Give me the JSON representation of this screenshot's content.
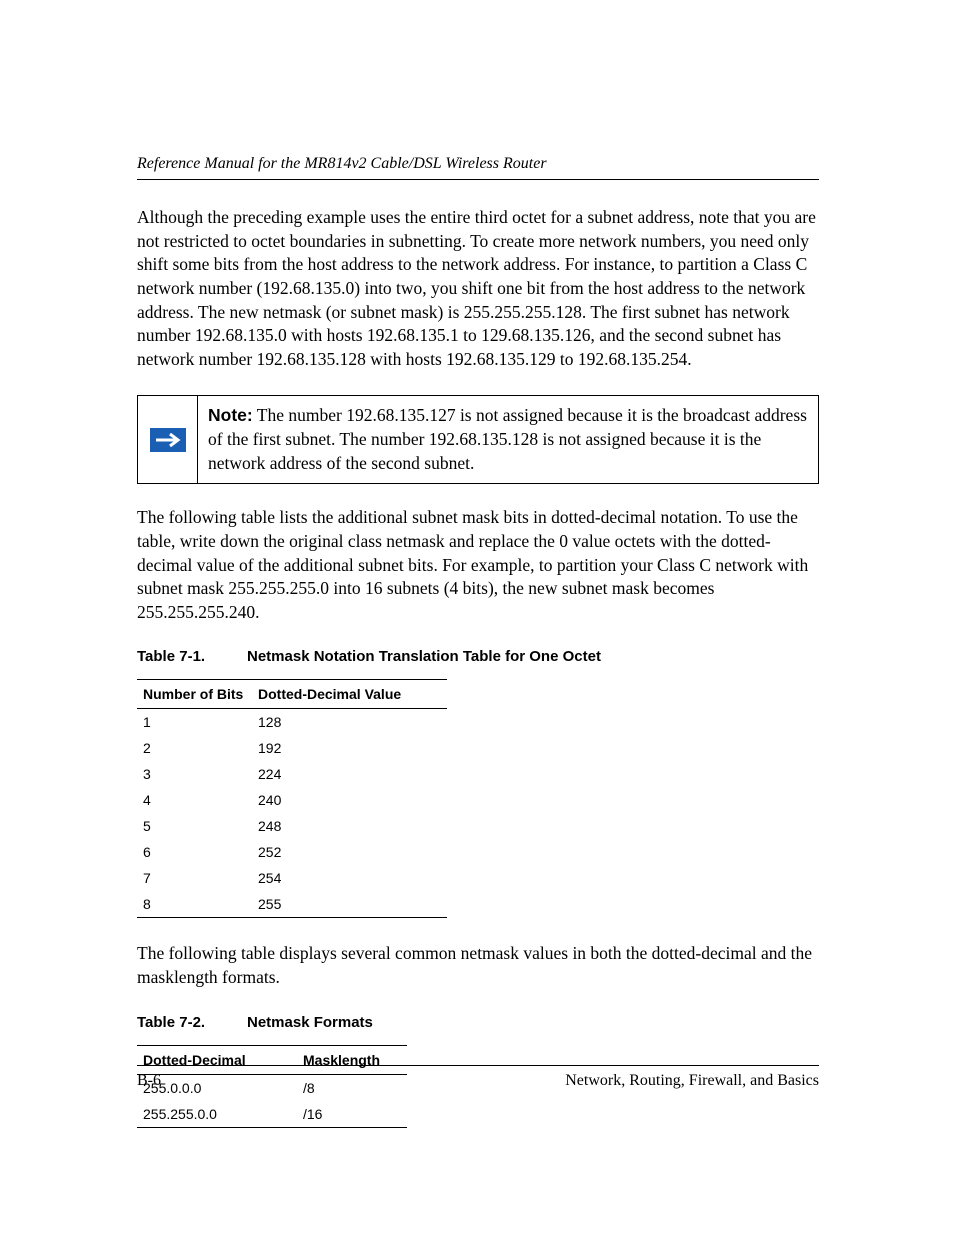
{
  "header": {
    "title": "Reference Manual for the MR814v2 Cable/DSL Wireless Router"
  },
  "para1": "Although the preceding example uses the entire third octet for a subnet address, note that you are not restricted to octet boundaries in subnetting. To create more network numbers, you need only shift some bits from the host address to the network address. For instance, to partition a Class C network number (192.68.135.0) into two, you shift one bit from the host address to the network address. The new netmask (or subnet mask) is 255.255.255.128. The first subnet has network number 192.68.135.0 with hosts 192.68.135.1 to 129.68.135.126, and the second subnet has network number 192.68.135.128 with hosts 192.68.135.129 to 192.68.135.254.",
  "note": {
    "label": "Note:",
    "text": " The number 192.68.135.127 is not assigned because it is the broadcast address of the first subnet. The number 192.68.135.128 is not assigned because it is the network address of the second subnet."
  },
  "para2": "The following table lists the additional subnet mask bits in dotted-decimal notation. To use the table, write down the original class netmask and replace the 0 value octets with the dotted-decimal value of the additional subnet bits. For example, to partition your Class C network with subnet mask 255.255.255.0 into 16 subnets (4 bits), the new subnet mask becomes 255.255.255.240.",
  "table1": {
    "number": "Table 7-1.",
    "title": "Netmask Notation Translation Table for One Octet",
    "headers": [
      "Number of Bits",
      "Dotted-Decimal Value"
    ],
    "rows": [
      [
        "1",
        "128"
      ],
      [
        "2",
        "192"
      ],
      [
        "3",
        "224"
      ],
      [
        "4",
        "240"
      ],
      [
        "5",
        "248"
      ],
      [
        "6",
        "252"
      ],
      [
        "7",
        "254"
      ],
      [
        "8",
        "255"
      ]
    ]
  },
  "para3": "The following table displays several common netmask values in both the dotted-decimal and the masklength formats.",
  "table2": {
    "number": "Table 7-2.",
    "title": "Netmask Formats",
    "headers": [
      "Dotted-Decimal",
      "Masklength"
    ],
    "rows": [
      [
        "255.0.0.0",
        "/8"
      ],
      [
        "255.255.0.0",
        "/16"
      ]
    ]
  },
  "footer": {
    "left": "B-6",
    "right": "Network, Routing, Firewall, and Basics"
  }
}
